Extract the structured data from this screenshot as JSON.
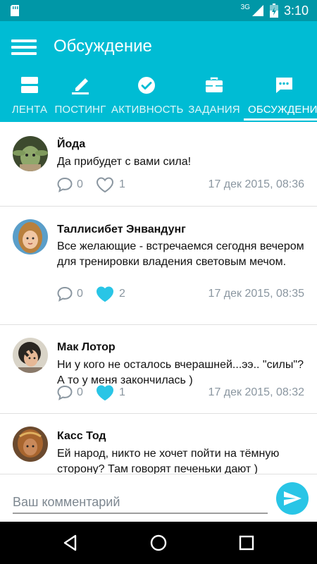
{
  "status_bar": {
    "network": "3G",
    "time": "3:10"
  },
  "app_bar": {
    "title": "Обсуждение",
    "menu_icon": "hamburger-menu-icon"
  },
  "tabs": [
    {
      "label": "ЛЕНТА",
      "icon": "feed-icon",
      "active": false
    },
    {
      "label": "ПОСТИНГ",
      "icon": "pencil-icon",
      "active": false
    },
    {
      "label": "АКТИВНОСТЬ",
      "icon": "check-circle-icon",
      "active": false
    },
    {
      "label": "ЗАДАНИЯ",
      "icon": "briefcase-icon",
      "active": false
    },
    {
      "label": "ОБСУЖДЕНИЕ",
      "icon": "chat-icon",
      "active": true
    }
  ],
  "comments": [
    {
      "author": "Йода",
      "text": "Да прибудет с вами сила!",
      "replies": "0",
      "likes": "1",
      "liked": false,
      "timestamp": "17 дек 2015, 08:36"
    },
    {
      "author": "Таллисибет Энвандунг",
      "text": "Все желающие - встречаемся сегодня вечером для тренировки владения световым мечом.",
      "replies": "0",
      "likes": "2",
      "liked": true,
      "timestamp": "17 дек 2015, 08:35"
    },
    {
      "author": "Мак Лотор",
      "text": "Ни у кого не осталось вчерашней...ээ.. \"силы\"? А то у меня закончилась )",
      "replies": "0",
      "likes": "1",
      "liked": true,
      "timestamp": "17 дек 2015, 08:32"
    },
    {
      "author": "Касс Тод",
      "text": "Ей народ, никто не хочет пойти на тёмную сторону? Там говорят печеньки дают )"
    }
  ],
  "composer": {
    "placeholder": "Ваш комментарий",
    "value": "",
    "send_icon": "send-icon"
  },
  "colors": {
    "primary": "#00bcd4",
    "primary_dark": "#0097a7",
    "accent": "#29c5e6",
    "meta_text": "#8a96a0"
  }
}
